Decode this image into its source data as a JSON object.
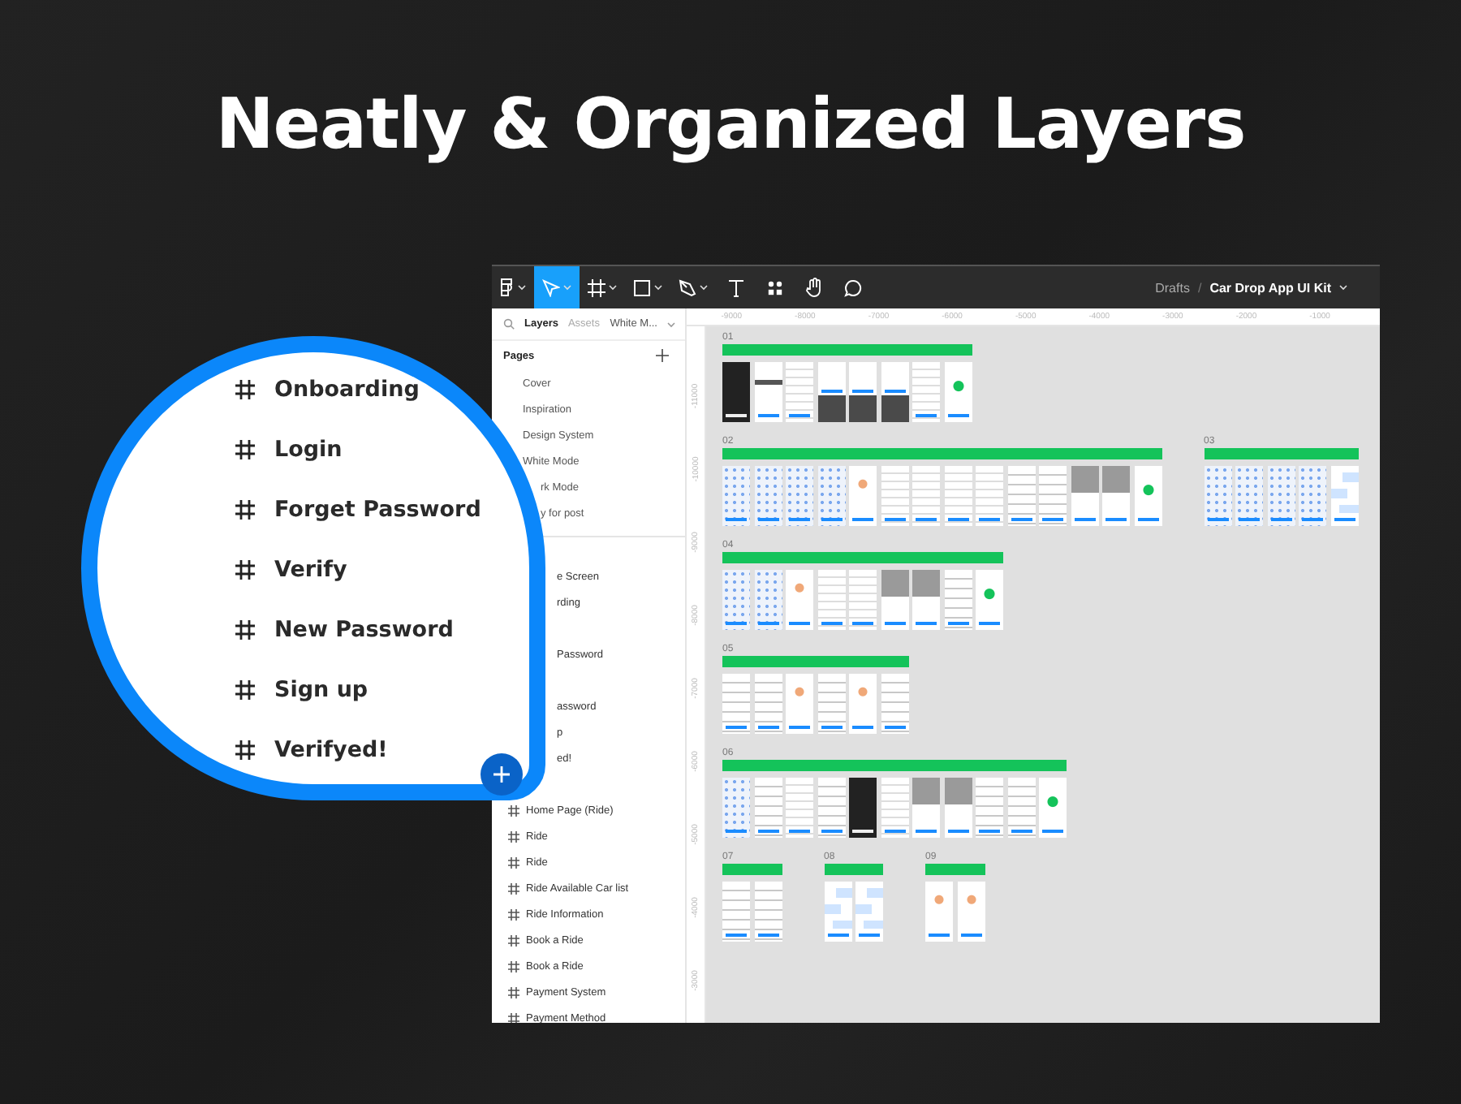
{
  "headline": "Neatly & Organized Layers",
  "toolbar": {
    "tools": [
      {
        "kind": "logo",
        "menu": true,
        "selected": false
      },
      {
        "kind": "move",
        "menu": true,
        "selected": true
      },
      {
        "kind": "frame",
        "menu": true,
        "selected": false
      },
      {
        "kind": "shape",
        "menu": true,
        "selected": false
      },
      {
        "kind": "pen",
        "menu": true,
        "selected": false
      },
      {
        "kind": "text",
        "menu": false,
        "selected": false
      },
      {
        "kind": "components",
        "menu": false,
        "selected": false
      },
      {
        "kind": "hand",
        "menu": false,
        "selected": false
      },
      {
        "kind": "comment",
        "menu": false,
        "selected": false
      }
    ],
    "breadcrumb": {
      "folder": "Drafts",
      "separator": "/",
      "file": "Car Drop App UI Kit"
    }
  },
  "panel": {
    "tabs": [
      {
        "label": "Layers",
        "selected": true
      },
      {
        "label": "Assets",
        "selected": false
      }
    ],
    "page_dropdown": "White M...",
    "pages_heading": "Pages",
    "pages": [
      {
        "label": "Cover",
        "kind": "page"
      },
      {
        "label": "Inspiration",
        "kind": "page"
      },
      {
        "label": "Design System",
        "kind": "page"
      },
      {
        "label": "White Mode",
        "kind": "page"
      },
      {
        "label": "rk Mode",
        "kind": "partial"
      },
      {
        "label": "y for post",
        "kind": "partial"
      }
    ],
    "layers": [
      {
        "kind": "partial",
        "label": "e Screen"
      },
      {
        "kind": "partial",
        "label": "rding"
      },
      {
        "kind": "covered"
      },
      {
        "kind": "partial",
        "label": "Password"
      },
      {
        "kind": "covered"
      },
      {
        "kind": "partial",
        "label": "assword"
      },
      {
        "kind": "partial",
        "label": "p"
      },
      {
        "kind": "partial",
        "label": "ed!"
      },
      {
        "kind": "covered"
      },
      {
        "kind": "frame",
        "label": "Home Page (Ride)"
      },
      {
        "kind": "frame",
        "label": "Ride"
      },
      {
        "kind": "frame",
        "label": "Ride"
      },
      {
        "kind": "frame",
        "label": "Ride Available Car list"
      },
      {
        "kind": "frame",
        "label": "Ride Information"
      },
      {
        "kind": "frame",
        "label": "Book a Ride"
      },
      {
        "kind": "frame",
        "label": "Book a Ride"
      },
      {
        "kind": "frame",
        "label": "Payment System"
      },
      {
        "kind": "frame",
        "label": "Payment Method"
      }
    ]
  },
  "top_ruler": [
    "-9000",
    "-8000",
    "-7000",
    "-6000",
    "-5000",
    "-4000",
    "-3000",
    "-2000",
    "-1000"
  ],
  "left_ruler": [
    "-11000",
    "-10000",
    "-9000",
    "-8000",
    "-7000",
    "-6000",
    "-5000",
    "-4000",
    "-3000"
  ],
  "canvas": {
    "rows": [
      {
        "sections": [
          {
            "number": "01",
            "frames": [
              {
                "kind": "dark"
              },
              {
                "kind": "light"
              },
              {
                "kind": "form"
              },
              {
                "kind": "keyboard"
              },
              {
                "kind": "keyboard"
              },
              {
                "kind": "keyboard"
              },
              {
                "kind": "form"
              },
              {
                "kind": "success"
              }
            ]
          }
        ]
      },
      {
        "sections": [
          {
            "number": "02",
            "frames": [
              {
                "kind": "map"
              },
              {
                "kind": "map"
              },
              {
                "kind": "map"
              },
              {
                "kind": "map"
              },
              {
                "kind": "profile"
              },
              {
                "kind": "form"
              },
              {
                "kind": "form"
              },
              {
                "kind": "form"
              },
              {
                "kind": "form"
              },
              {
                "kind": "list"
              },
              {
                "kind": "list"
              },
              {
                "kind": "grey"
              },
              {
                "kind": "grey"
              },
              {
                "kind": "success"
              }
            ]
          },
          {
            "number": "03",
            "frames": [
              {
                "kind": "map"
              },
              {
                "kind": "map"
              },
              {
                "kind": "map"
              },
              {
                "kind": "map"
              },
              {
                "kind": "chat"
              }
            ]
          }
        ]
      },
      {
        "sections": [
          {
            "number": "04",
            "frames": [
              {
                "kind": "map"
              },
              {
                "kind": "map"
              },
              {
                "kind": "profile"
              },
              {
                "kind": "form"
              },
              {
                "kind": "form"
              },
              {
                "kind": "grey"
              },
              {
                "kind": "grey"
              },
              {
                "kind": "list"
              },
              {
                "kind": "success"
              }
            ]
          }
        ]
      },
      {
        "sections": [
          {
            "number": "05",
            "frames": [
              {
                "kind": "list"
              },
              {
                "kind": "list"
              },
              {
                "kind": "profile"
              },
              {
                "kind": "list"
              },
              {
                "kind": "profile"
              },
              {
                "kind": "list"
              }
            ]
          }
        ]
      },
      {
        "sections": [
          {
            "number": "06",
            "frames": [
              {
                "kind": "map"
              },
              {
                "kind": "list"
              },
              {
                "kind": "form"
              },
              {
                "kind": "list"
              },
              {
                "kind": "dark"
              },
              {
                "kind": "form"
              },
              {
                "kind": "grey"
              },
              {
                "kind": "grey"
              },
              {
                "kind": "list"
              },
              {
                "kind": "list"
              },
              {
                "kind": "success"
              }
            ]
          }
        ]
      },
      {
        "sections": [
          {
            "number": "07",
            "frames": [
              {
                "kind": "list"
              },
              {
                "kind": "list"
              }
            ]
          },
          {
            "number": "08",
            "frames": [
              {
                "kind": "chat"
              },
              {
                "kind": "chat"
              }
            ]
          },
          {
            "number": "09",
            "frames": [
              {
                "kind": "profile"
              },
              {
                "kind": "profile"
              }
            ]
          }
        ]
      }
    ]
  },
  "zoom_callout": {
    "layers": [
      "Onboarding",
      "Login",
      "Forget Password",
      "Verify",
      "New Password",
      "Sign up",
      "Verifyed!"
    ]
  }
}
